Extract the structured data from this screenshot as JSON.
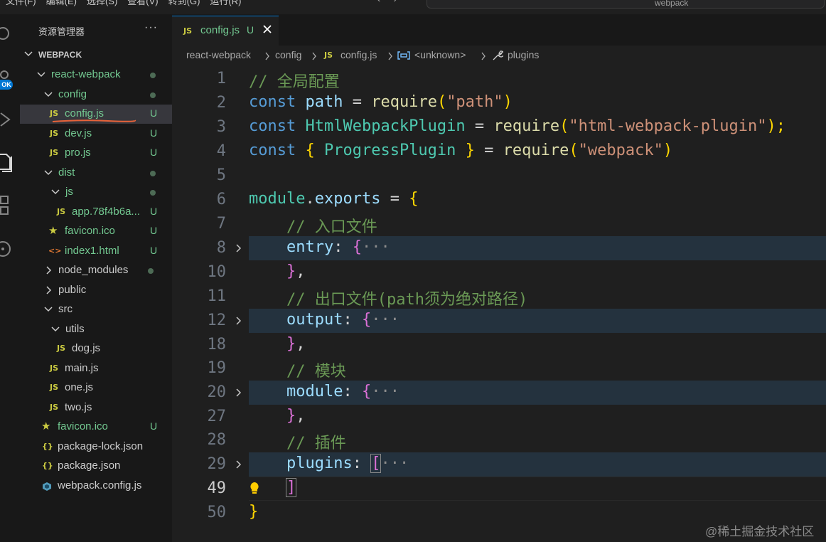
{
  "menubar": {
    "items": [
      "文件(F)",
      "编辑(E)",
      "选择(S)",
      "查看(V)",
      "转到(G)",
      "运行(R)"
    ],
    "search_text": "webpack"
  },
  "activity": {
    "badge": "OK"
  },
  "sidebar": {
    "title": "资源管理器",
    "more": "···",
    "root": "WEBPACK",
    "items": [
      {
        "name": "react-webpack",
        "status": ""
      },
      {
        "name": "config",
        "status": ""
      },
      {
        "name": "config.js",
        "status": "U"
      },
      {
        "name": "dev.js",
        "status": "U"
      },
      {
        "name": "pro.js",
        "status": "U"
      },
      {
        "name": "dist",
        "status": ""
      },
      {
        "name": "js",
        "status": ""
      },
      {
        "name": "app.78f4b6a...",
        "status": "U"
      },
      {
        "name": "favicon.ico",
        "status": "U"
      },
      {
        "name": "index1.html",
        "status": "U"
      },
      {
        "name": "node_modules",
        "status": ""
      },
      {
        "name": "public",
        "status": ""
      },
      {
        "name": "src",
        "status": ""
      },
      {
        "name": "utils",
        "status": ""
      },
      {
        "name": "dog.js",
        "status": ""
      },
      {
        "name": "main.js",
        "status": ""
      },
      {
        "name": "one.js",
        "status": ""
      },
      {
        "name": "two.js",
        "status": ""
      },
      {
        "name": "favicon.ico",
        "status": "U"
      },
      {
        "name": "package-lock.json",
        "status": ""
      },
      {
        "name": "package.json",
        "status": ""
      },
      {
        "name": "webpack.config.js",
        "status": ""
      }
    ]
  },
  "icons": {
    "js": "JS",
    "json": "{}",
    "html": "<>",
    "star": "★"
  },
  "editor": {
    "tab": {
      "name": "config.js",
      "status": "U"
    },
    "breadcrumb": [
      "react-webpack",
      "config",
      "config.js",
      "<unknown>",
      "plugins"
    ],
    "lines": [
      {
        "n": "1",
        "t": [
          "// 全局配置"
        ]
      },
      {
        "n": "2",
        "t": [
          "const",
          "path",
          "=",
          "require",
          "(",
          "\"path\"",
          ")"
        ]
      },
      {
        "n": "3",
        "t": [
          "const",
          "HtmlWebpackPlugin",
          "=",
          "require",
          "(",
          "\"html-webpack-plugin\"",
          ");"
        ]
      },
      {
        "n": "4",
        "t": [
          "const",
          "{",
          "ProgressPlugin",
          "}",
          "=",
          "require",
          "(",
          "\"webpack\"",
          ")"
        ]
      },
      {
        "n": "5",
        "t": []
      },
      {
        "n": "6",
        "t": [
          "module",
          ".",
          "exports",
          "=",
          "{"
        ]
      },
      {
        "n": "7",
        "t": [
          "// 入口文件"
        ]
      },
      {
        "n": "8",
        "t": [
          "entry",
          ":",
          "{",
          "···"
        ]
      },
      {
        "n": "10",
        "t": [
          "}",
          ","
        ]
      },
      {
        "n": "11",
        "t": [
          "// 出口文件(path须为绝对路径)"
        ]
      },
      {
        "n": "12",
        "t": [
          "output",
          ":",
          "{",
          "···"
        ]
      },
      {
        "n": "18",
        "t": [
          "}",
          ","
        ]
      },
      {
        "n": "19",
        "t": [
          "// 模块"
        ]
      },
      {
        "n": "20",
        "t": [
          "module",
          ":",
          "{",
          "···"
        ]
      },
      {
        "n": "27",
        "t": [
          "}",
          ","
        ]
      },
      {
        "n": "28",
        "t": [
          "// 插件"
        ]
      },
      {
        "n": "29",
        "t": [
          "plugins",
          ":",
          "[",
          "···"
        ]
      },
      {
        "n": "49",
        "t": [
          "]"
        ]
      },
      {
        "n": "50",
        "t": [
          "}"
        ]
      }
    ]
  },
  "watermark": "@稀土掘金技术社区",
  "colors": {
    "accent": "#0078d4",
    "untracked": "#73c991",
    "js_icon": "#cbcb41",
    "fold_highlight": "#24323e",
    "annotation_underline": "#e8633a"
  }
}
